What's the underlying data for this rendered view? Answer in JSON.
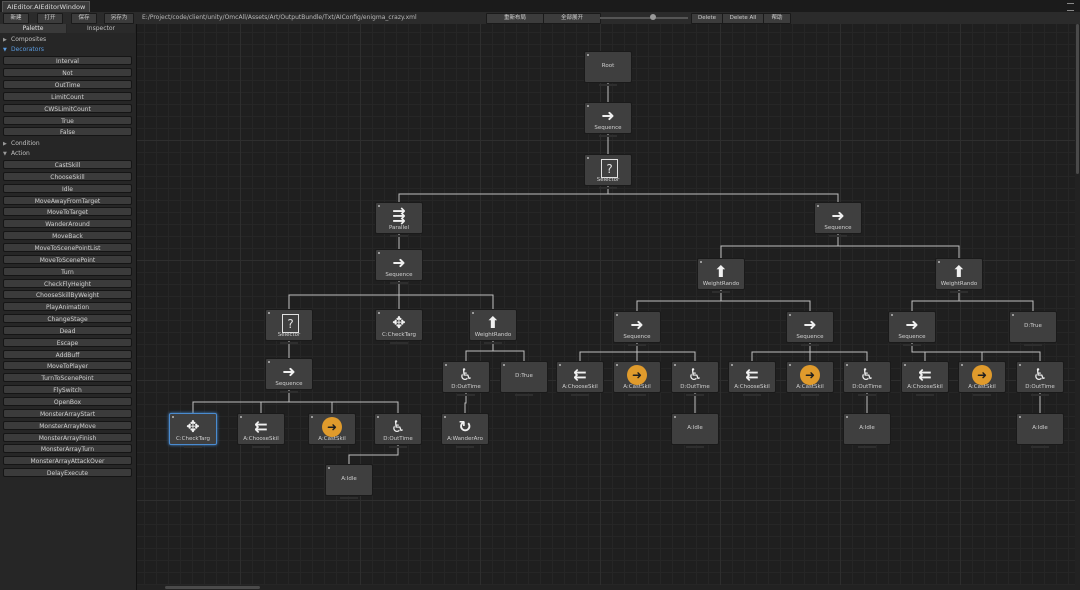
{
  "window": {
    "title": "AIEditor.AIEditorWindow"
  },
  "toolbar": {
    "left_buttons": [
      "新建",
      "打开",
      "保存",
      "另存为"
    ],
    "path": "E:/Project/code/client/unity/OmcAll/Assets/Art/OutputBundle/Txt/AIConfig/enigma_crazy.xml",
    "center_buttons": [
      "重新布局",
      "全部展开"
    ],
    "right_buttons": [
      "Delete",
      "Delete All",
      "帮助"
    ]
  },
  "panel": {
    "tabs": [
      "Palette",
      "Inspector"
    ],
    "sections": [
      {
        "label": "Composites",
        "expanded": false
      },
      {
        "label": "Decorators",
        "expanded": true,
        "highlight": true,
        "items": [
          "Interval",
          "Not",
          "OutTime",
          "LimitCount",
          "CWSLimitCount",
          "True",
          "False"
        ]
      },
      {
        "label": "Condition",
        "expanded": false
      },
      {
        "label": "Action",
        "expanded": true,
        "items": [
          "CastSkill",
          "ChooseSkill",
          "Idle",
          "MoveAwayFromTarget",
          "MoveToTarget",
          "WanderAround",
          "MoveBack",
          "MoveToScenePointList",
          "MoveToScenePoint",
          "Turn",
          "CheckFlyHeight",
          "ChooseSkillByWeight",
          "PlayAnimation",
          "ChangeStage",
          "Dead",
          "Escape",
          "AddBuff",
          "MoveToPlayer",
          "TurnToScenePoint",
          "FlySwitch",
          "OpenBox",
          "MonsterArrayStart",
          "MonsterArrayMove",
          "MonsterArrayFinish",
          "MonsterArrayTurn",
          "MonsterArrayAttackOver",
          "DelayExecute"
        ]
      }
    ]
  },
  "graph": {
    "colors": {
      "accent": "#e09b2c",
      "selection": "#4a8bd0",
      "edge": "#bfbfbf"
    },
    "nodes": [
      {
        "id": "root",
        "label": "Root",
        "icon": "none"
      },
      {
        "id": "seq1",
        "label": "Sequence",
        "icon": "arrow-right-icon"
      },
      {
        "id": "sel1",
        "label": "Selector",
        "icon": "question-icon"
      },
      {
        "id": "par1",
        "label": "Parallel",
        "icon": "parallel-arrows-icon"
      },
      {
        "id": "seq2",
        "label": "Sequence",
        "icon": "arrow-right-icon"
      },
      {
        "id": "seq3",
        "label": "Sequence",
        "icon": "arrow-right-icon"
      },
      {
        "id": "sel2",
        "label": "Selector",
        "icon": "question-icon"
      },
      {
        "id": "chk1",
        "label": "C:CheckTarg",
        "icon": "move-cross-icon"
      },
      {
        "id": "wr1",
        "label": "WeightRando",
        "icon": "arrow-up-icon"
      },
      {
        "id": "seq4",
        "label": "Sequence",
        "icon": "arrow-right-icon"
      },
      {
        "id": "chk2",
        "label": "C:CheckTarg",
        "icon": "move-cross-icon",
        "selected": true
      },
      {
        "id": "ch1",
        "label": "A:ChooseSkil",
        "icon": "choose-arrows-icon"
      },
      {
        "id": "cs1",
        "label": "A:CastSkil",
        "icon": "play-circle-icon"
      },
      {
        "id": "ot1",
        "label": "D:OutTime",
        "icon": "wheelchair-icon"
      },
      {
        "id": "idle1",
        "label": "A:Idle",
        "icon": "none"
      },
      {
        "id": "ot2",
        "label": "D:OutTime",
        "icon": "wheelchair-icon"
      },
      {
        "id": "dt1",
        "label": "D:True",
        "icon": "none"
      },
      {
        "id": "wa1",
        "label": "A:WanderAro",
        "icon": "refresh-icon"
      },
      {
        "id": "wr2",
        "label": "WeightRando",
        "icon": "arrow-up-icon"
      },
      {
        "id": "wr3",
        "label": "WeightRando",
        "icon": "arrow-up-icon"
      },
      {
        "id": "seqA",
        "label": "Sequence",
        "icon": "arrow-right-icon"
      },
      {
        "id": "seqB",
        "label": "Sequence",
        "icon": "arrow-right-icon"
      },
      {
        "id": "seqC",
        "label": "Sequence",
        "icon": "arrow-right-icon"
      },
      {
        "id": "dt2",
        "label": "D:True",
        "icon": "none"
      },
      {
        "id": "chA",
        "label": "A:ChooseSkil",
        "icon": "choose-arrows-icon"
      },
      {
        "id": "csA",
        "label": "A:CastSkil",
        "icon": "play-circle-icon"
      },
      {
        "id": "otA",
        "label": "D:OutTime",
        "icon": "wheelchair-icon"
      },
      {
        "id": "idleA",
        "label": "A:Idle",
        "icon": "none"
      },
      {
        "id": "chB",
        "label": "A:ChooseSkil",
        "icon": "choose-arrows-icon"
      },
      {
        "id": "csB",
        "label": "A:CastSkil",
        "icon": "play-circle-icon"
      },
      {
        "id": "otB",
        "label": "D:OutTime",
        "icon": "wheelchair-icon"
      },
      {
        "id": "idleB",
        "label": "A:Idle",
        "icon": "none"
      },
      {
        "id": "chC",
        "label": "A:ChooseSkil",
        "icon": "choose-arrows-icon"
      },
      {
        "id": "csC",
        "label": "A:CastSkil",
        "icon": "play-circle-icon"
      },
      {
        "id": "otC",
        "label": "D:OutTime",
        "icon": "wheelchair-icon"
      },
      {
        "id": "idleC",
        "label": "A:Idle",
        "icon": "none"
      }
    ],
    "edges": [
      [
        "root",
        "seq1"
      ],
      [
        "seq1",
        "sel1"
      ],
      [
        "sel1",
        "par1"
      ],
      [
        "sel1",
        "seq3"
      ],
      [
        "par1",
        "seq2"
      ],
      [
        "seq2",
        "sel2"
      ],
      [
        "seq2",
        "chk1"
      ],
      [
        "seq2",
        "wr1"
      ],
      [
        "sel2",
        "seq4"
      ],
      [
        "seq4",
        "chk2"
      ],
      [
        "seq4",
        "ch1"
      ],
      [
        "seq4",
        "cs1"
      ],
      [
        "seq4",
        "ot1"
      ],
      [
        "ot1",
        "idle1"
      ],
      [
        "wr1",
        "ot2"
      ],
      [
        "wr1",
        "dt1"
      ],
      [
        "ot2",
        "wa1"
      ],
      [
        "seq3",
        "wr2"
      ],
      [
        "seq3",
        "wr3"
      ],
      [
        "wr2",
        "seqA"
      ],
      [
        "wr2",
        "seqB"
      ],
      [
        "wr3",
        "seqC"
      ],
      [
        "wr3",
        "dt2"
      ],
      [
        "seqA",
        "chA"
      ],
      [
        "seqA",
        "csA"
      ],
      [
        "seqA",
        "otA"
      ],
      [
        "otA",
        "idleA"
      ],
      [
        "seqB",
        "chB"
      ],
      [
        "seqB",
        "csB"
      ],
      [
        "seqB",
        "otB"
      ],
      [
        "otB",
        "idleB"
      ],
      [
        "seqC",
        "chC"
      ],
      [
        "seqC",
        "csC"
      ],
      [
        "seqC",
        "otC"
      ],
      [
        "otC",
        "idleC"
      ]
    ]
  }
}
